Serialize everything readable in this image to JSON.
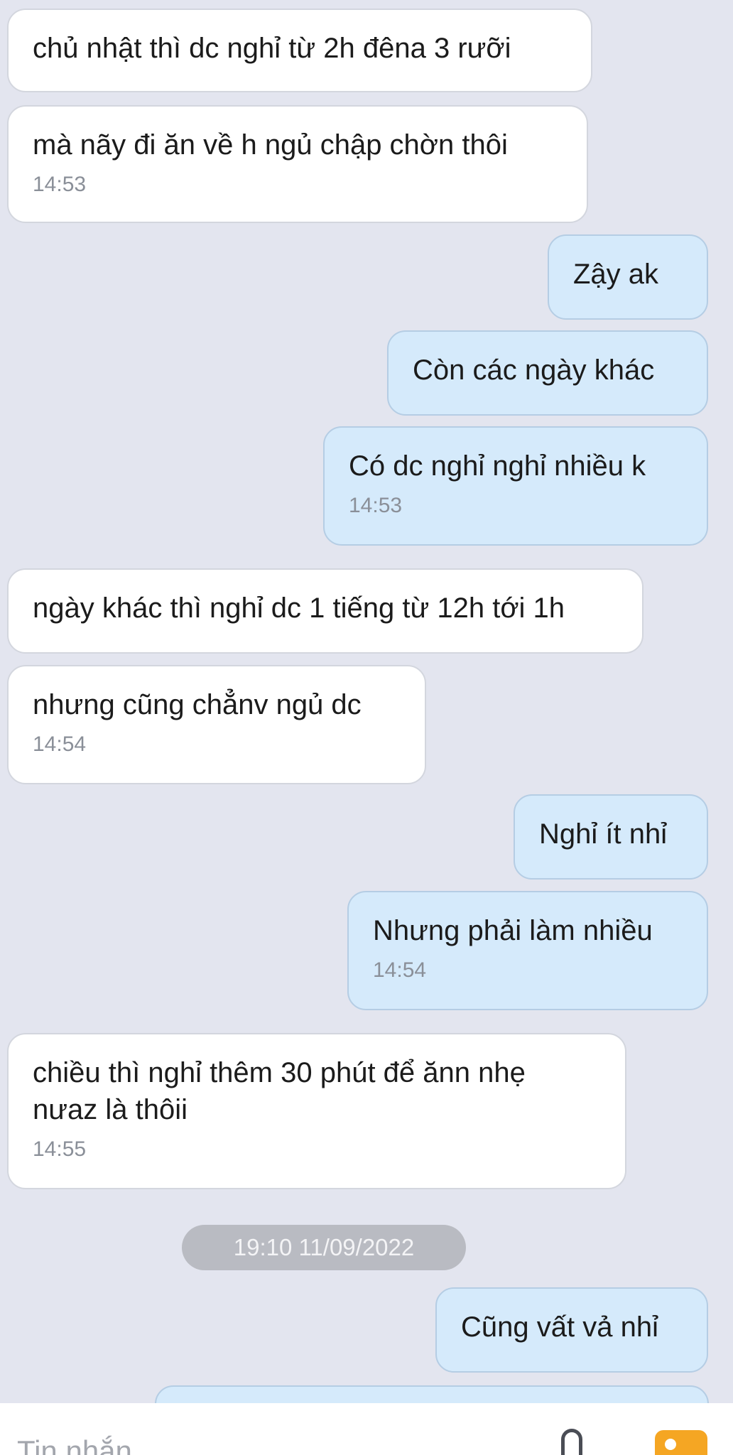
{
  "messages": [
    {
      "side": "in",
      "text": "chủ nhật thì dc nghỉ từ 2h đêna 3 rưỡi",
      "time": ""
    },
    {
      "side": "in",
      "text": "mà nãy đi ăn về h ngủ chập chờn thôi",
      "time": "14:53"
    },
    {
      "side": "out",
      "text": "Zậy ak",
      "time": ""
    },
    {
      "side": "out",
      "text": "Còn các ngày khác",
      "time": ""
    },
    {
      "side": "out",
      "text": "Có dc nghỉ nghỉ nhiều k",
      "time": "14:53"
    },
    {
      "side": "in",
      "text": "ngày khác thì nghỉ dc 1 tiếng từ 12h tới 1h",
      "time": ""
    },
    {
      "side": "in",
      "text": "nhưng cũng chẳnv ngủ dc",
      "time": "14:54"
    },
    {
      "side": "out",
      "text": "Nghỉ ít nhỉ",
      "time": ""
    },
    {
      "side": "out",
      "text": "Nhưng phải làm nhiều",
      "time": "14:54"
    },
    {
      "side": "in",
      "text": "chiều thì nghỉ thêm 30 phút để ănn nhẹ\nnưaz là thôii",
      "time": "14:55"
    },
    {
      "side": "out",
      "text": "Cũng vất vả nhỉ",
      "time": ""
    }
  ],
  "date_divider": "19:10 11/09/2022",
  "composer": {
    "placeholder": "Tin nhắn",
    "icons": [
      "more-icon",
      "attachment-icon",
      "image-icon"
    ]
  },
  "colors": {
    "background": "#e3e5ef",
    "incoming_bubble": "#ffffff",
    "outgoing_bubble": "#d5eafb",
    "date_pill": "#b9bbc2",
    "image_icon": "#f5a623"
  }
}
